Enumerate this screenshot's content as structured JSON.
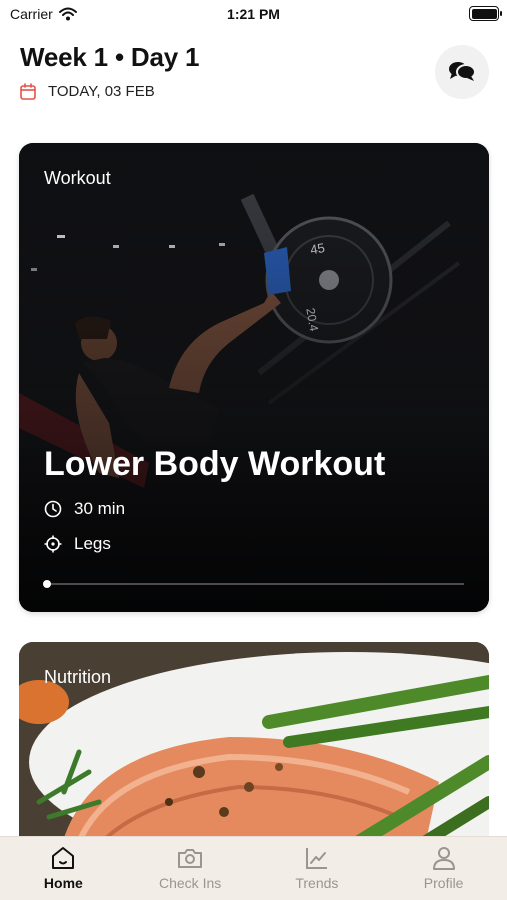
{
  "status_bar": {
    "carrier": "Carrier",
    "time": "1:21 PM"
  },
  "header": {
    "title": "Week 1 • Day 1",
    "date": "TODAY, 03 FEB",
    "accent_color": "#e5534b"
  },
  "workout_card": {
    "tag": "Workout",
    "title": "Lower Body Workout",
    "duration": "30 min",
    "focus": "Legs",
    "progress": 0.0
  },
  "nutrition_card": {
    "tag": "Nutrition"
  },
  "tabs": [
    {
      "label": "Home",
      "icon": "home-icon",
      "active": true
    },
    {
      "label": "Check Ins",
      "icon": "camera-icon",
      "active": false
    },
    {
      "label": "Trends",
      "icon": "chart-icon",
      "active": false
    },
    {
      "label": "Profile",
      "icon": "user-icon",
      "active": false
    }
  ]
}
